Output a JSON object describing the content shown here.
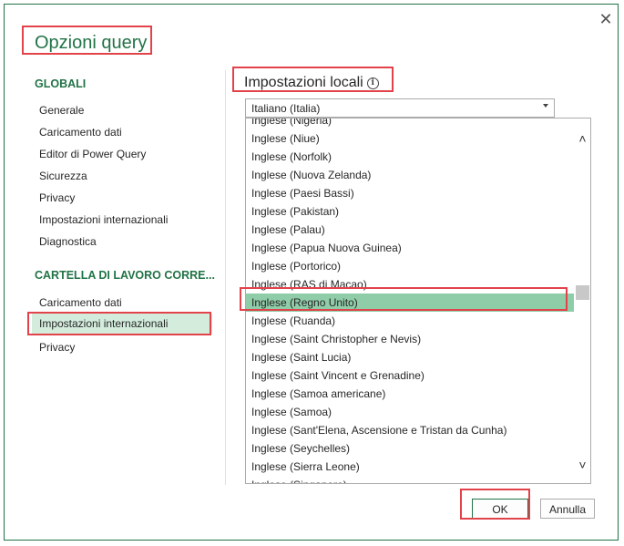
{
  "dialog": {
    "title": "Opzioni query",
    "close_icon": "close-icon"
  },
  "sidebar": {
    "globali": {
      "header": "GLOBALI",
      "items": [
        {
          "label": "Generale"
        },
        {
          "label": "Caricamento dati"
        },
        {
          "label": "Editor di Power Query"
        },
        {
          "label": "Sicurezza"
        },
        {
          "label": "Privacy"
        },
        {
          "label": "Impostazioni internazionali"
        },
        {
          "label": "Diagnostica"
        }
      ]
    },
    "cartella": {
      "header": "CARTELLA DI LAVORO CORRE...",
      "items": [
        {
          "label": "Caricamento dati"
        },
        {
          "label": "Impostazioni internazionali",
          "selected": true
        },
        {
          "label": "Privacy"
        }
      ]
    }
  },
  "main": {
    "section_title": "Impostazioni locali",
    "info_icon": "info-icon",
    "locale_select": {
      "value": "Italiano (Italia)"
    },
    "locale_list": {
      "items": [
        "Inglese (Nigeria)",
        "Inglese (Niue)",
        "Inglese (Norfolk)",
        "Inglese (Nuova Zelanda)",
        "Inglese (Paesi Bassi)",
        "Inglese (Pakistan)",
        "Inglese (Palau)",
        "Inglese (Papua Nuova Guinea)",
        "Inglese (Portorico)",
        "Inglese (RAS di Macao)",
        "Inglese (Regno Unito)",
        "Inglese (Ruanda)",
        "Inglese (Saint Christopher e Nevis)",
        "Inglese (Saint Lucia)",
        "Inglese (Saint Vincent e Grenadine)",
        "Inglese (Samoa americane)",
        "Inglese (Samoa)",
        "Inglese (Sant'Elena, Ascensione e Tristan da Cunha)",
        "Inglese (Seychelles)",
        "Inglese (Sierra Leone)",
        "Inglese (Singapore)"
      ],
      "selected": "Inglese (Regno Unito)"
    }
  },
  "buttons": {
    "ok": "OK",
    "cancel": "Annulla"
  },
  "colors": {
    "accent": "#217346",
    "selection": "#8fcca8",
    "highlight_box": "#e2434b"
  }
}
